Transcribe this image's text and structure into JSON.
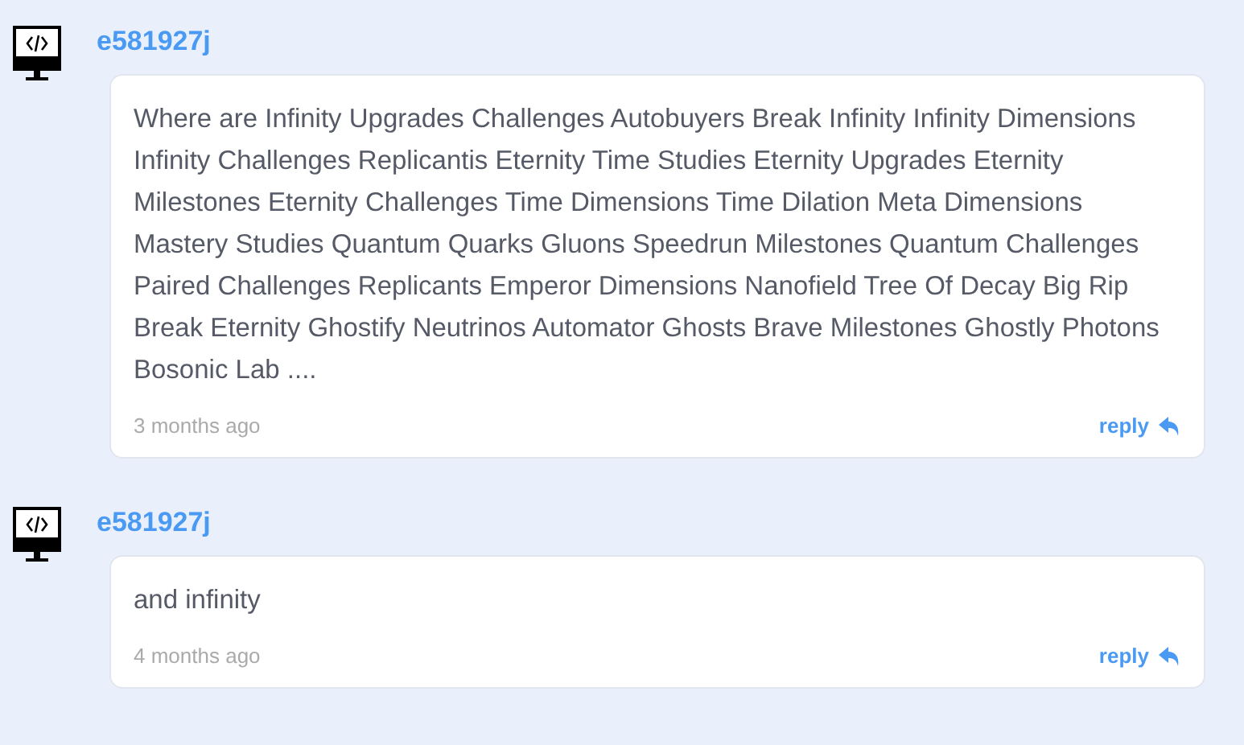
{
  "comments": [
    {
      "author": "e581927j",
      "text": "Where are Infinity Upgrades Challenges Autobuyers Break Infinity Infinity Dimensions Infinity Challenges Replicantis Eternity Time Studies Eternity Upgrades Eternity Milestones Eternity Challenges Time Dimensions Time Dilation Meta Dimensions Mastery Studies Quantum Quarks Gluons Speedrun Milestones Quantum Challenges Paired Challenges Replicants Emperor Dimensions Nanofield Tree Of Decay Big Rip Break Eternity Ghostify Neutrinos Automator Ghosts Brave Milestones Ghostly Photons Bosonic Lab ....",
      "time": "3 months ago",
      "reply": "reply"
    },
    {
      "author": "e581927j",
      "text": "and infinity",
      "time": "4 months ago",
      "reply": "reply"
    }
  ]
}
